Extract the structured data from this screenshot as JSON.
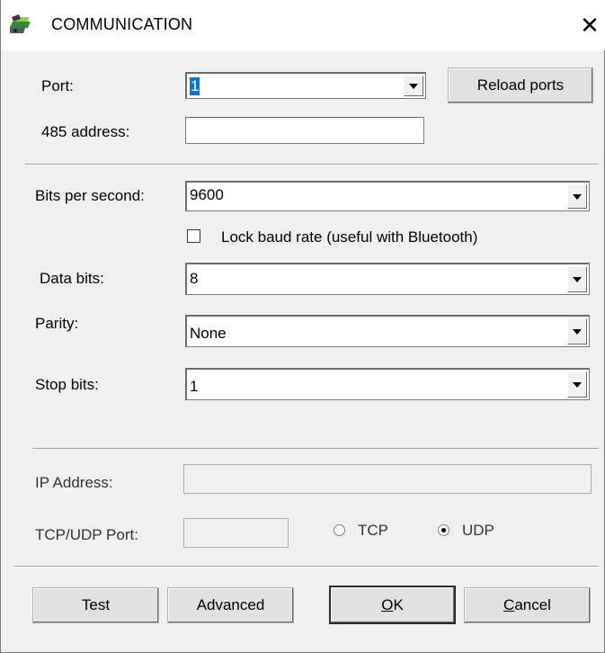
{
  "window": {
    "title": "COMMUNICATION",
    "close_symbol": "✕"
  },
  "port": {
    "label": "Port:",
    "value": "1",
    "reload_button": "Reload ports"
  },
  "address": {
    "label": "485 address:",
    "value": ""
  },
  "bits_per_second": {
    "label": "Bits per second:",
    "value": "9600"
  },
  "lock_baud": {
    "label": "Lock baud rate (useful with Bluetooth)",
    "checked": false
  },
  "data_bits": {
    "label": "Data bits:",
    "value": "8"
  },
  "parity": {
    "label": "Parity:",
    "value": "None"
  },
  "stop_bits": {
    "label": "Stop bits:",
    "value": "1"
  },
  "ip_address": {
    "label": "IP Address:",
    "value": ""
  },
  "tcp_udp_port": {
    "label": "TCP/UDP Port:",
    "value": ""
  },
  "protocol": {
    "tcp_label": "TCP",
    "udp_label": "UDP",
    "selected": "UDP"
  },
  "buttons": {
    "test": "Test",
    "advanced": "Advanced",
    "ok_mnemonic": "O",
    "ok_rest": "K",
    "cancel_mnemonic": "C",
    "cancel_rest": "ancel"
  }
}
